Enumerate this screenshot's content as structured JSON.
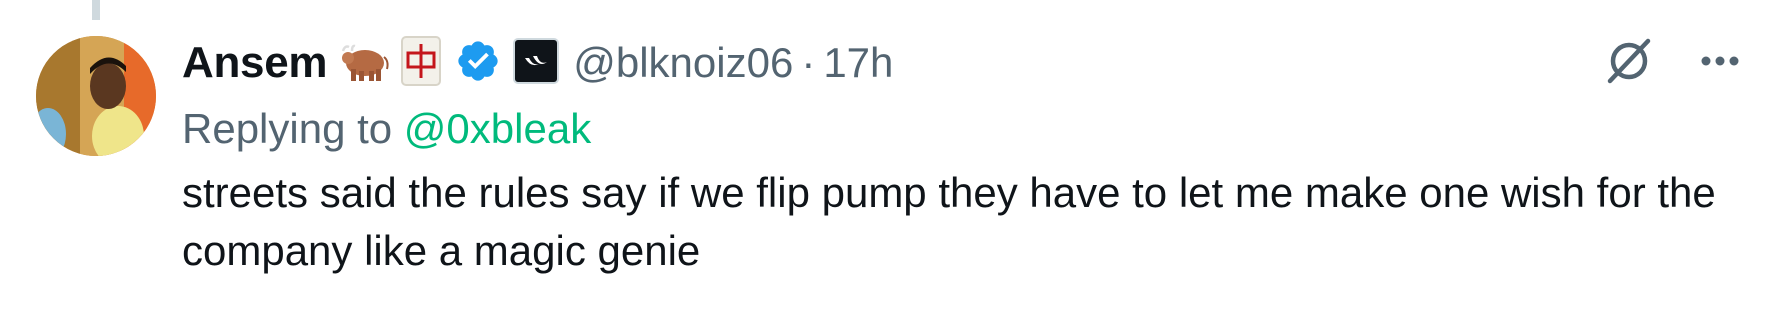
{
  "tweet": {
    "display_name": "Ansem",
    "handle": "@blknoiz06",
    "separator": "·",
    "timestamp": "17h",
    "reply_prefix": "Replying to",
    "reply_to_handle": "@0xbleak",
    "text": "streets said the rules say if we flip pump they have to let me make one wish for the company like a magic genie",
    "verified_badge_color": "#1d9bf0",
    "mention_color": "#00ba7c",
    "icons": {
      "badge_1": "ox-emoji-icon",
      "badge_2": "mahjong-red-dragon-icon",
      "badge_3": "verified-badge-icon",
      "badge_4": "affiliate-logo-icon",
      "action_1": "grok-icon",
      "action_2": "more-options-icon"
    }
  }
}
